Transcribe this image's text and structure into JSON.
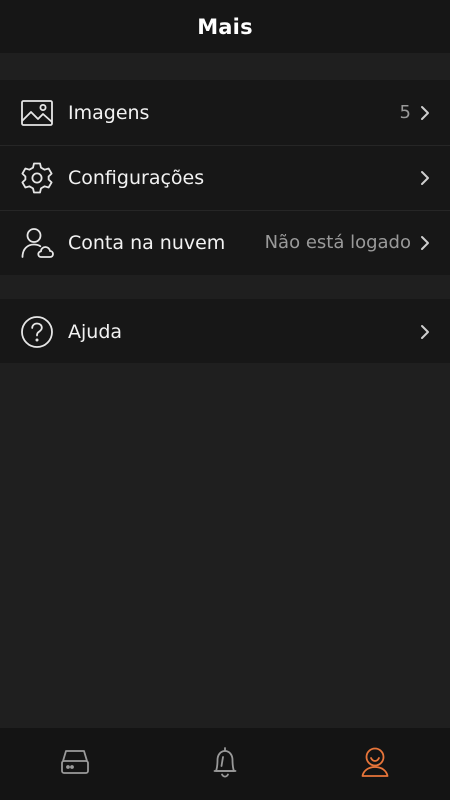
{
  "header": {
    "title": "Mais"
  },
  "menu": {
    "images": {
      "label": "Imagens",
      "value": "5",
      "icon": "image-icon"
    },
    "settings": {
      "label": "Configurações",
      "icon": "gear-icon"
    },
    "cloud_account": {
      "label": "Conta na nuvem",
      "value": "Não está logado",
      "icon": "user-cloud-icon"
    },
    "help": {
      "label": "Ajuda",
      "icon": "help-icon"
    }
  },
  "tabbar": {
    "items": [
      {
        "icon": "device-icon",
        "active": false
      },
      {
        "icon": "alarm-bell-icon",
        "active": false
      },
      {
        "icon": "profile-icon",
        "active": true
      }
    ],
    "active_color": "#e8753a",
    "inactive_color": "#9a9a9a"
  },
  "colors": {
    "background": "#1f1f1f",
    "header_background": "#161616",
    "section_background": "#171717",
    "tabbar_background": "#141414",
    "text_primary": "#f2f2f2",
    "text_secondary": "#9a9a9a"
  }
}
